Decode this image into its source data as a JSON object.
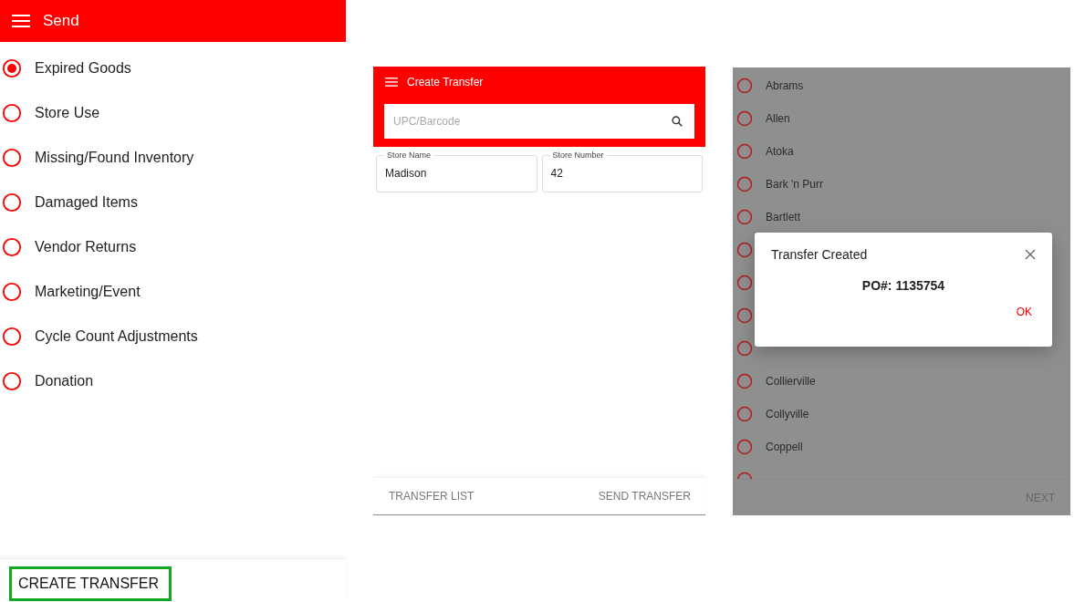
{
  "send_panel": {
    "title": "Send",
    "options": [
      {
        "label": "Expired Goods",
        "selected": true
      },
      {
        "label": "Store Use",
        "selected": false
      },
      {
        "label": "Missing/Found Inventory",
        "selected": false
      },
      {
        "label": "Damaged Items",
        "selected": false
      },
      {
        "label": "Vendor Returns",
        "selected": false
      },
      {
        "label": "Marketing/Event",
        "selected": false
      },
      {
        "label": "Cycle Count Adjustments",
        "selected": false
      },
      {
        "label": "Donation",
        "selected": false
      }
    ],
    "create_button": "CREATE TRANSFER"
  },
  "transfer_panel": {
    "title": "Create Transfer",
    "search": {
      "placeholder": "UPC/Barcode"
    },
    "fields": [
      {
        "label": "Store Name",
        "value": "Madison"
      },
      {
        "label": "Store Number",
        "value": "42"
      }
    ],
    "footer_buttons": [
      "TRANSFER LIST",
      "SEND TRANSFER"
    ]
  },
  "store_panel": {
    "stores": [
      {
        "label": "Abrams",
        "selected": false
      },
      {
        "label": "Allen",
        "selected": false
      },
      {
        "label": "Atoka",
        "selected": false
      },
      {
        "label": "Bark 'n Purr",
        "selected": false
      },
      {
        "label": "Bartlett",
        "selected": false
      },
      {
        "selected": false
      },
      {
        "selected": false
      },
      {
        "selected": false
      },
      {
        "selected": false
      },
      {
        "label": "Collierville",
        "selected": false
      },
      {
        "label": "Collyville",
        "selected": false
      },
      {
        "label": "Coppell",
        "selected": false
      },
      {
        "selected": false
      }
    ],
    "next_button": "NEXT",
    "dialog": {
      "title": "Transfer Created",
      "message": "PO#: 1135754",
      "ok": "OK"
    }
  }
}
